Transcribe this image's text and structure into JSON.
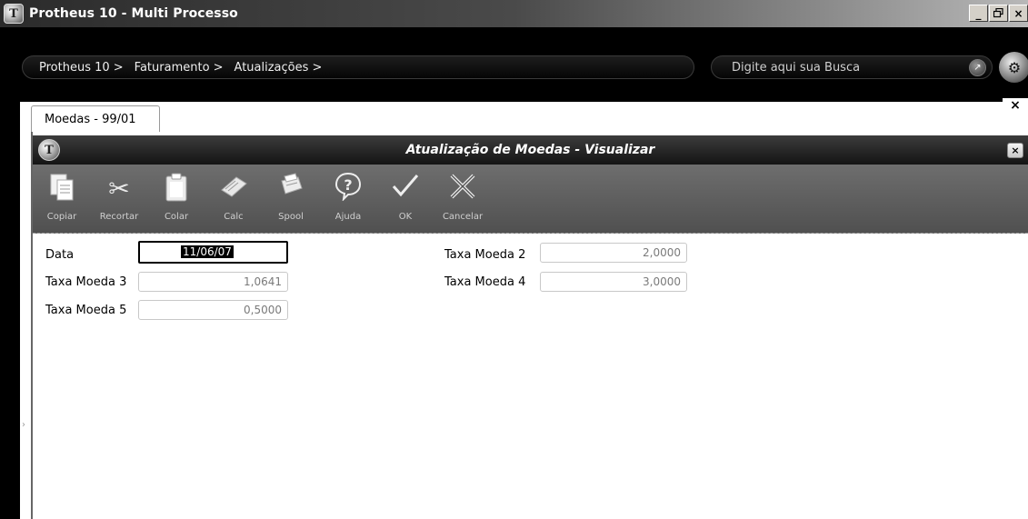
{
  "window": {
    "title": "Protheus 10 - Multi Processo",
    "icon": "protheus-icon",
    "controls": {
      "minimize": "_",
      "restore": "Θ",
      "close": "×"
    }
  },
  "nav": {
    "breadcrumbs": [
      "Protheus 10 >",
      "Faturamento >",
      "Atualizações >"
    ],
    "search": {
      "placeholder": "Digite aqui sua Busca",
      "icon": "search-go-icon"
    },
    "gear_icon": "gear-icon"
  },
  "tab": {
    "label": "Moedas - 99/01",
    "close": "×"
  },
  "dialog": {
    "title": "Atualização de Moedas - Visualizar",
    "close": "×",
    "toolbar": [
      {
        "key": "copiar",
        "label": "Copiar",
        "icon": "copy-icon"
      },
      {
        "key": "recortar",
        "label": "Recortar",
        "icon": "scissors-icon"
      },
      {
        "key": "colar",
        "label": "Colar",
        "icon": "clipboard-icon"
      },
      {
        "key": "calc",
        "label": "Calc",
        "icon": "calculator-icon"
      },
      {
        "key": "spool",
        "label": "Spool",
        "icon": "printer-icon"
      },
      {
        "key": "ajuda",
        "label": "Ajuda",
        "icon": "help-icon"
      },
      {
        "key": "ok",
        "label": "OK",
        "icon": "check-icon"
      },
      {
        "key": "cancelar",
        "label": "Cancelar",
        "icon": "cancel-icon"
      }
    ]
  },
  "form": {
    "data": {
      "label": "Data",
      "value": "11/06/07"
    },
    "taxa2": {
      "label": "Taxa Moeda 2",
      "value": "2,0000"
    },
    "taxa3": {
      "label": "Taxa Moeda 3",
      "value": "1,0641"
    },
    "taxa4": {
      "label": "Taxa Moeda 4",
      "value": "3,0000"
    },
    "taxa5": {
      "label": "Taxa Moeda 5",
      "value": "0,5000"
    }
  }
}
